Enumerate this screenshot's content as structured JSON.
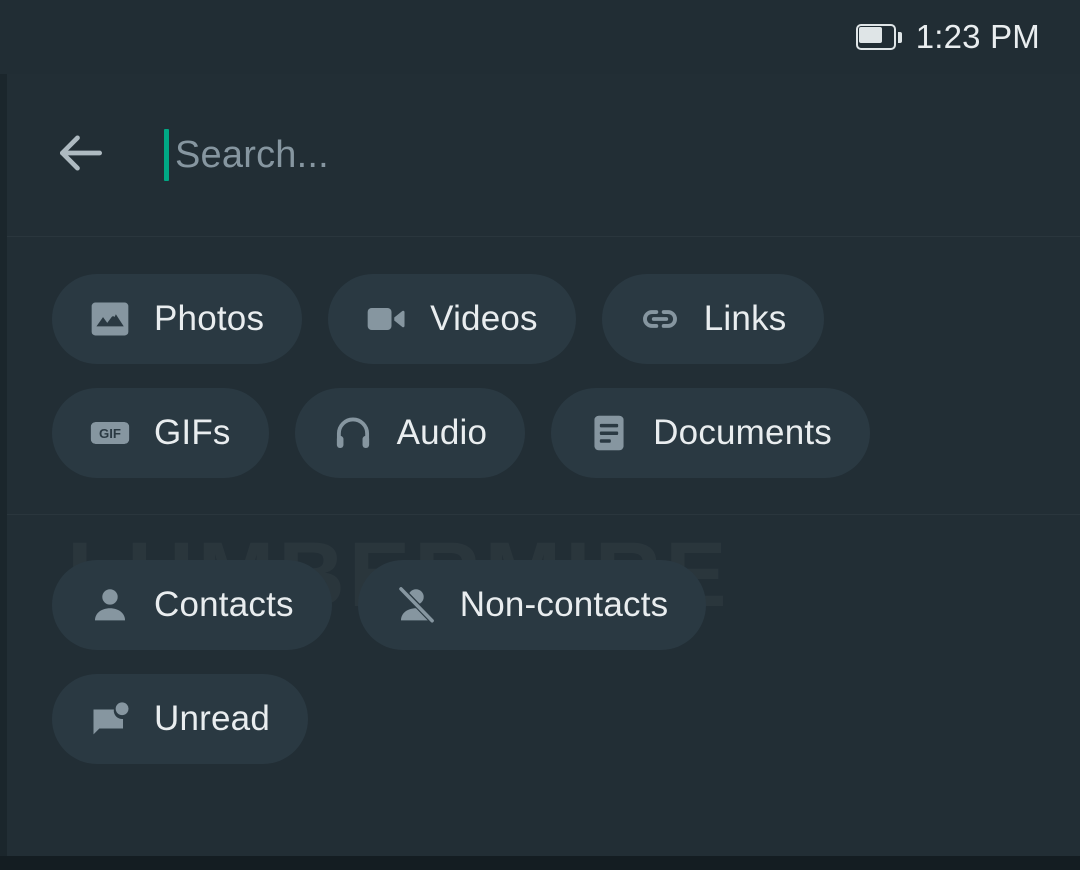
{
  "status_bar": {
    "time": "1:23 PM",
    "battery_icon": "battery-icon",
    "battery_level_percent": 60
  },
  "search_header": {
    "back_icon": "arrow-left-icon",
    "placeholder": "Search...",
    "value": "",
    "caret_color": "#00a884"
  },
  "colors": {
    "background": "#222e35",
    "chip_fill": "#2a3942",
    "text_primary": "#e9edef",
    "text_secondary": "#8696a0",
    "accent": "#00a884",
    "divider": "#2a363d",
    "edge_strip": "#1b262c",
    "bottom_bar": "#141d22"
  },
  "media_filters": {
    "rows": [
      [
        {
          "label": "Photos",
          "icon": "image-icon"
        },
        {
          "label": "Videos",
          "icon": "video-camera-icon"
        },
        {
          "label": "Links",
          "icon": "link-icon"
        }
      ],
      [
        {
          "label": "GIFs",
          "icon": "gif-icon"
        },
        {
          "label": "Audio",
          "icon": "headphones-icon"
        },
        {
          "label": "Documents",
          "icon": "document-icon"
        }
      ]
    ]
  },
  "chat_filters": {
    "watermark": "LUMBERMIRE",
    "rows": [
      [
        {
          "label": "Contacts",
          "icon": "person-icon"
        },
        {
          "label": "Non-contacts",
          "icon": "person-slash-icon"
        }
      ],
      [
        {
          "label": "Unread",
          "icon": "unread-message-icon"
        }
      ]
    ]
  }
}
